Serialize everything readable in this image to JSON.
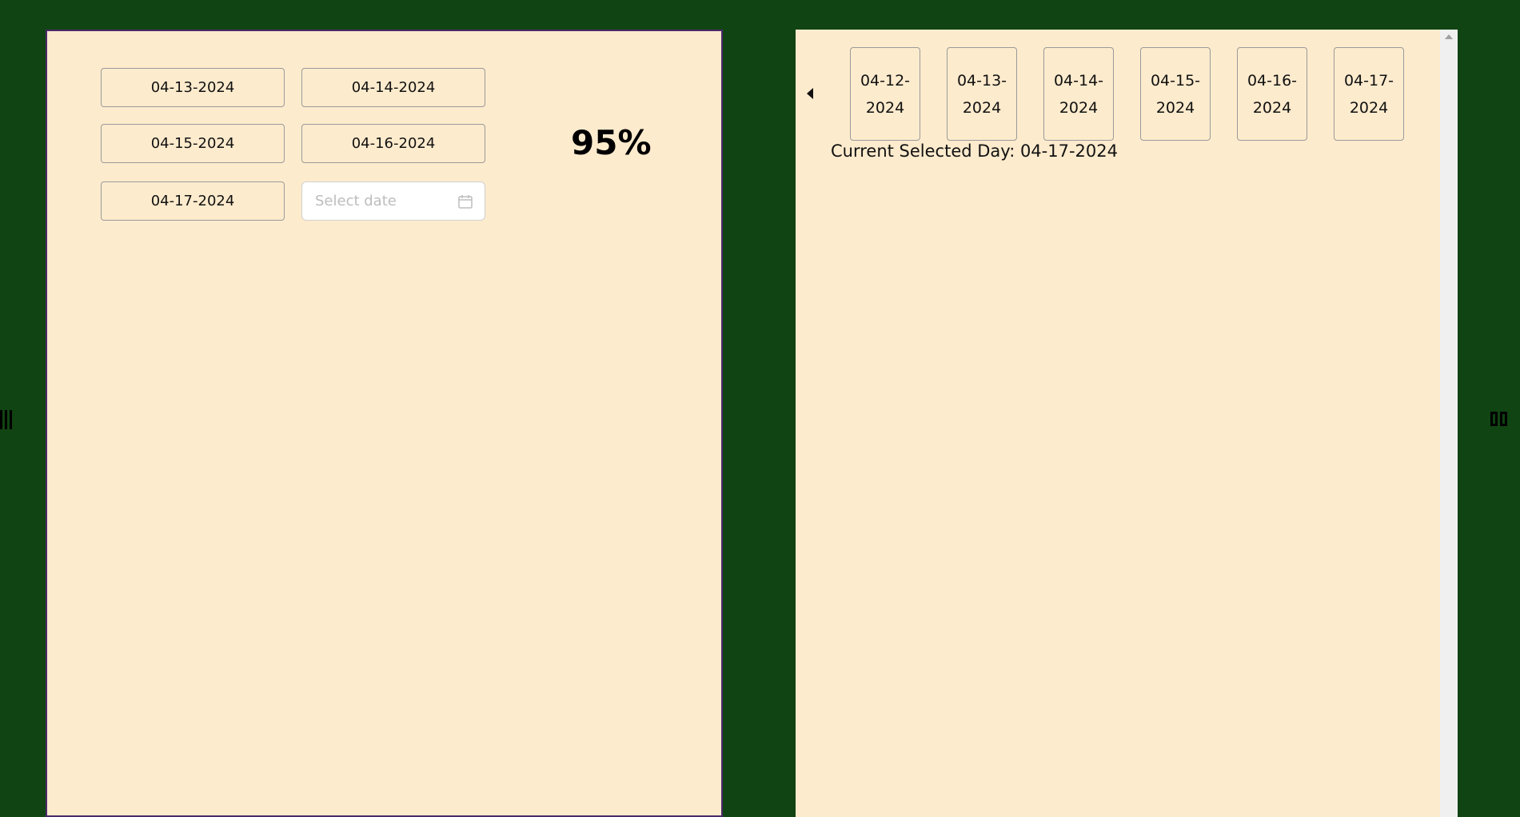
{
  "left_panel": {
    "date_buttons": [
      "04-13-2024",
      "04-14-2024",
      "04-15-2024",
      "04-16-2024",
      "04-17-2024"
    ],
    "date_picker_placeholder": "Select date",
    "progress_label": "95%"
  },
  "right_panel": {
    "day_buttons": [
      "04-12-2024",
      "04-13-2024",
      "04-14-2024",
      "04-15-2024",
      "04-16-2024",
      "04-17-2024"
    ],
    "current_day_label": "Current Selected Day: 04-17-2024"
  },
  "colors": {
    "page_background": "#114413",
    "panel_background": "#fdebcd",
    "left_panel_border": "#4a2a6a"
  },
  "icons": {
    "calendar": "calendar-icon",
    "prev": "caret-left-icon",
    "next": "caret-right-icon",
    "left_edge": "bars-icon",
    "right_edge": "columns-icon"
  }
}
